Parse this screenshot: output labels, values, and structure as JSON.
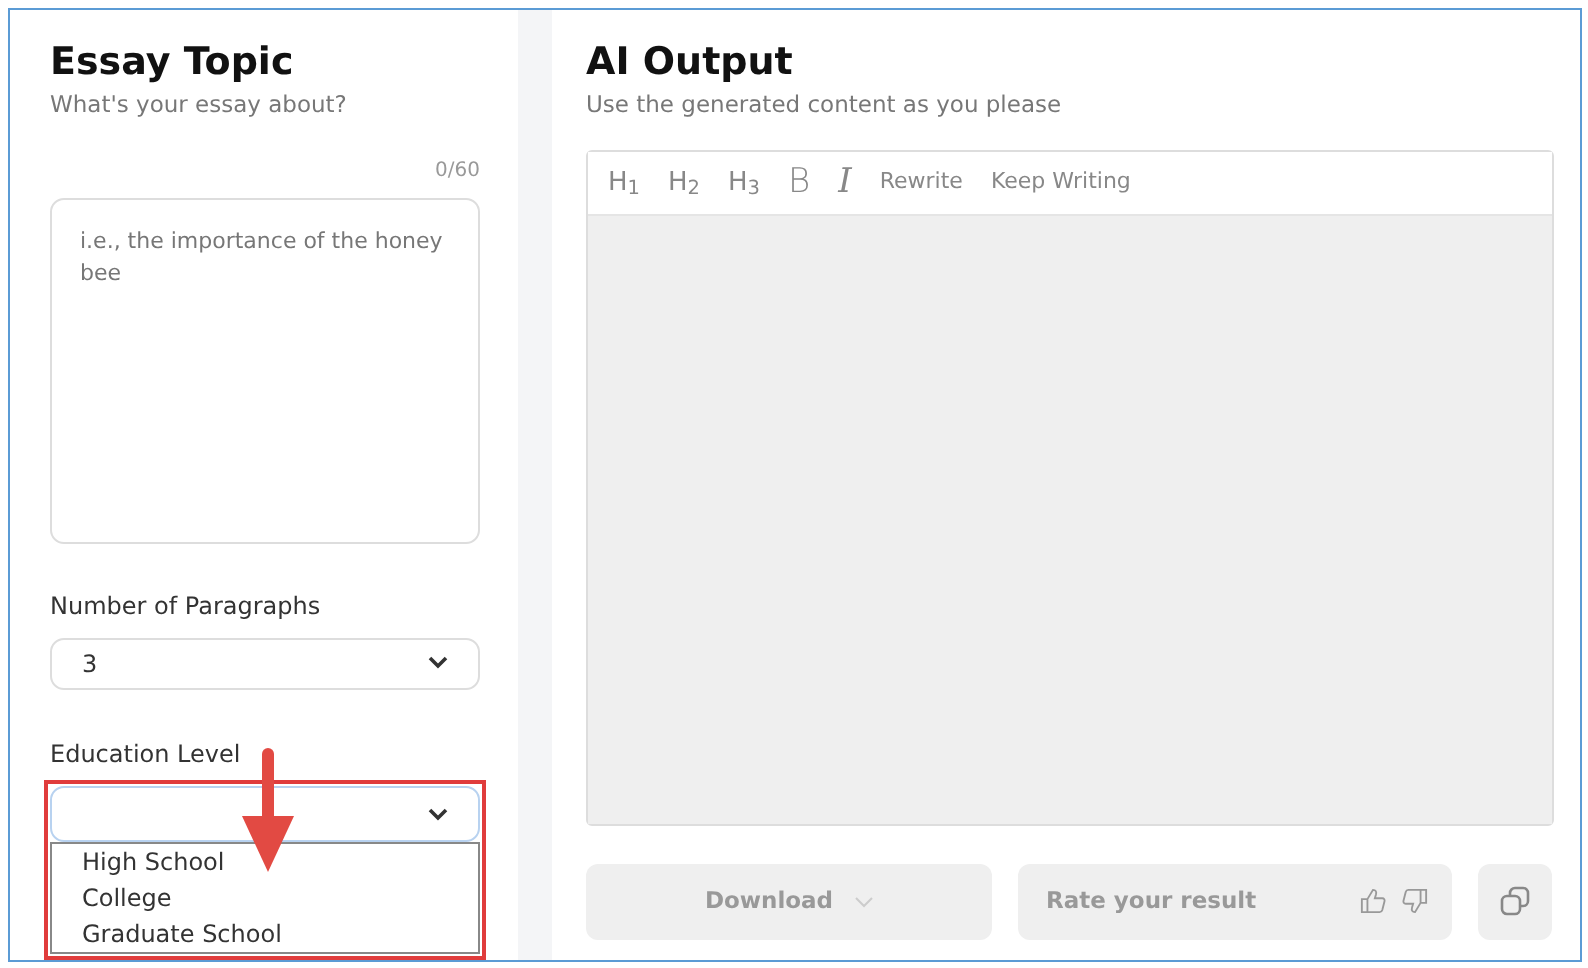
{
  "topic": {
    "title": "Essay Topic",
    "subtitle": "What's your essay about?",
    "counter": "0/60",
    "placeholder": "i.e., the importance of the honey bee"
  },
  "paragraphs": {
    "label": "Number of Paragraphs",
    "value": "3"
  },
  "education": {
    "label": "Education Level",
    "expanded": true,
    "options": [
      {
        "label": "High School",
        "selected": false
      },
      {
        "label": "College",
        "selected": false
      },
      {
        "label": "Graduate School",
        "selected": false
      }
    ]
  },
  "output": {
    "title": "AI Output",
    "subtitle": "Use the generated content as you please"
  },
  "toolbar": [
    {
      "kind": "heading",
      "label": "H$_{1}$"
    },
    {
      "kind": "heading",
      "label": "H$_{2}$"
    },
    {
      "kind": "heading",
      "label": "H$_{3}$"
    },
    {
      "kind": "bold",
      "label": "B"
    },
    {
      "kind": "italic",
      "label": "I"
    },
    {
      "kind": "text",
      "label": "Rewrite"
    },
    {
      "kind": "text",
      "label": "Keep Writing"
    }
  ],
  "actions": {
    "download": "Download",
    "rate": "Rate your result"
  }
}
